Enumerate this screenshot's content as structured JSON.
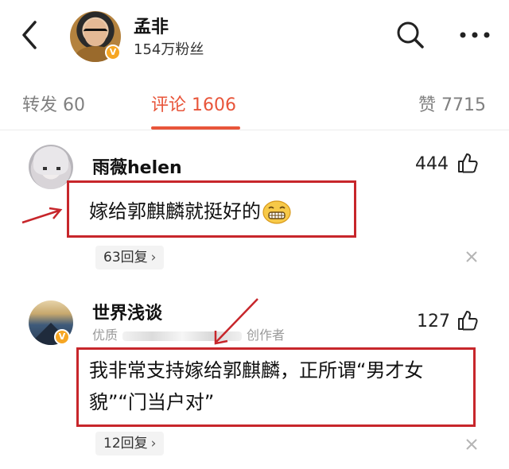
{
  "header": {
    "user_name": "孟非",
    "fans": "154万粉丝",
    "verified_mark": "V",
    "icons": [
      "back-arrow-icon",
      "search-icon",
      "more-icon"
    ]
  },
  "tabs": {
    "repost": "转发 60",
    "comments": "评论 1606",
    "likes": "赞 7715",
    "active": "comments",
    "accent_color": "#e8553a"
  },
  "comments": [
    {
      "user": "雨薇helen",
      "likes": "444",
      "text": "嫁给郭麒麟就挺好的",
      "emoji": "grinning-emoji",
      "replies": "63回复",
      "highlight_color": "#c7262b"
    },
    {
      "user": "世界浅谈",
      "subtitle_prefix": "优质",
      "subtitle_suffix": "创作者",
      "verified_mark": "V",
      "likes": "127",
      "text": "我非常支持嫁给郭麒麟，正所谓“男才女貌”“门当户对”",
      "replies": "12回复",
      "highlight_color": "#c7262b"
    }
  ],
  "colors": {
    "annotation_red": "#c7262b",
    "badge_orange": "#f6a623"
  }
}
